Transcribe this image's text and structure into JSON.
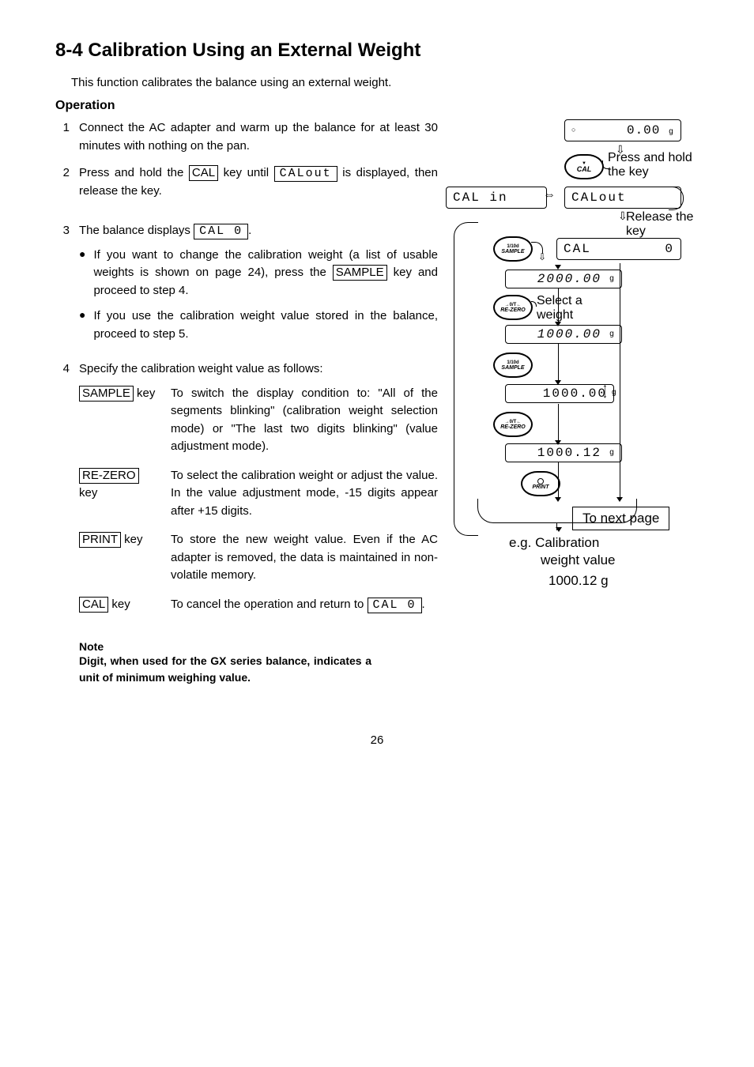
{
  "heading": "8-4  Calibration Using an External Weight",
  "intro": "This function calibrates the balance using an external weight.",
  "operation_label": "Operation",
  "steps": {
    "s1": {
      "num": "1",
      "text_a": "Connect the AC adapter and warm up the balance for at least 30 minutes with nothing on the pan."
    },
    "s2": {
      "num": "2",
      "text_a": "Press and hold the ",
      "key": "CAL",
      "text_b": " key until ",
      "code": "CALout",
      "text_c": " is displayed, then release the key."
    },
    "s3": {
      "num": "3",
      "text_a": "The balance displays ",
      "code": "CAL 0",
      "text_b": ".",
      "b1_a": "If you want to change the calibration weight (a list of usable weights is shown on page 24), press the ",
      "b1_key": "SAMPLE",
      "b1_b": " key and proceed to step 4.",
      "b2": "If you use the calibration weight value stored in the balance, proceed to step 5."
    },
    "s4": {
      "num": "4",
      "text": "Specify the calibration weight value as follows:"
    }
  },
  "keytable": {
    "r1": {
      "label_key": "SAMPLE",
      "label_suffix": " key",
      "desc": "To switch the display condition to: \"All of the segments blinking\" (calibration weight selection mode) or \"The last two digits blinking\" (value adjustment mode)."
    },
    "r2": {
      "label_key": "RE-ZERO",
      "label_suffix": " key",
      "desc": "To select the calibration weight or adjust the value. In the value adjustment mode, -15 digits appear after +15 digits."
    },
    "r3": {
      "label_key": "PRINT",
      "label_suffix": " key",
      "desc": "To store the new weight value. Even if the AC adapter is removed, the data is maintained in non-volatile memory."
    },
    "r4": {
      "label_key": "CAL",
      "label_suffix": " key",
      "desc_a": "To cancel the operation and return to ",
      "desc_code": "CAL 0",
      "desc_b": "."
    }
  },
  "note": {
    "head": "Note",
    "body": "Digit, when used for the GX series balance, indicates a unit of minimum weighing value."
  },
  "pagenum": "26",
  "diagram": {
    "lcd0": {
      "val": "0.00",
      "unit": "g",
      "stable": "○"
    },
    "anno_press": "Press and hold the key",
    "key_cal_top": "▼",
    "key_cal": "CAL",
    "lcd_calin": "CAL  in",
    "lcd_calout": "CALout",
    "anno_release": "Release the key",
    "key_sample_top": "1/10d",
    "key_sample": "SAMPLE",
    "lcd_cal0_a": "CAL",
    "lcd_cal0_b": "0",
    "lcd_2000": "2000.00",
    "unit_g": "g",
    "key_rezero_top": "→0/T←",
    "key_rezero": "RE-ZERO",
    "anno_select": "Select a weight",
    "lcd_1000a": "1000.00",
    "lcd_1000b": "1000.00",
    "lcd_100012": "1000.12",
    "key_print_top": "○",
    "key_print": "PRINT",
    "to_next": "To next page",
    "eg_a": "e.g. Calibration",
    "eg_b": "weight value",
    "eg_c": "1000.12 g"
  }
}
